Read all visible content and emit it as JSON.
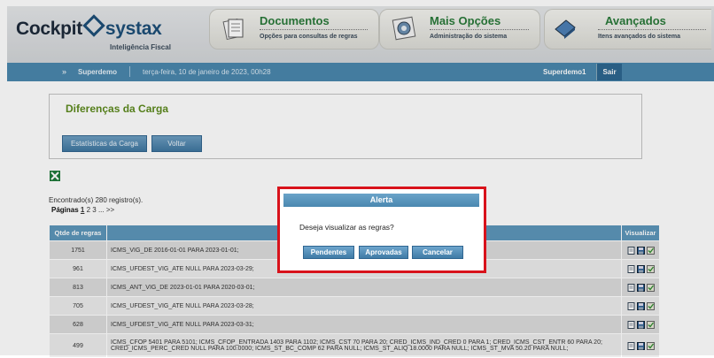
{
  "header": {
    "logo_left": "Cockpit",
    "logo_right": "systax",
    "logo_subtitle": "Inteligência Fiscal",
    "tabs": [
      {
        "title": "Documentos",
        "subtitle": "Opções para consultas de regras",
        "icon": "documents-icon"
      },
      {
        "title": "Mais Opções",
        "subtitle": "Administração do sistema",
        "icon": "gear-icon"
      },
      {
        "title": "Avançados",
        "subtitle": "Itens avançados do sistema",
        "icon": "pen-icon"
      }
    ]
  },
  "topbar": {
    "arrow": "»",
    "user": "Superdemo",
    "date": "terça-feira, 10 de janeiro de 2023, 00h28",
    "user_right": "Superdemo1",
    "logout": "Sair"
  },
  "panel": {
    "title": "Diferenças da Carga",
    "btn_stats": "Estatísticas da Carga",
    "btn_back": "Voltar"
  },
  "results": {
    "found": "Encontrado(s) 280 registro(s).",
    "pages_label": "Páginas",
    "pages_current": "1",
    "pages_rest": "2 3 ... >>"
  },
  "table": {
    "headers": [
      "Qtde de regras",
      "",
      "Visualizar"
    ],
    "rows": [
      {
        "qty": "1751",
        "rule": "ICMS_VIG_DE 2016-01-01 PARA 2023-01-01;"
      },
      {
        "qty": "961",
        "rule": "ICMS_UFDEST_VIG_ATE NULL PARA 2023-03-29;"
      },
      {
        "qty": "813",
        "rule": "ICMS_ANT_VIG_DE 2023-01-01 PARA 2020-03-01;"
      },
      {
        "qty": "705",
        "rule": "ICMS_UFDEST_VIG_ATE NULL PARA 2023-03-28;"
      },
      {
        "qty": "628",
        "rule": "ICMS_UFDEST_VIG_ATE NULL PARA 2023-03-31;"
      },
      {
        "qty": "499",
        "rule": "ICMS_CFOP 5401 PARA 5101; ICMS_CFOP_ENTRADA 1403 PARA 1102; ICMS_CST 70 PARA 20; CRED_ICMS_IND_CRED 0 PARA 1; CRED_ICMS_CST_ENTR 60 PARA 20; CRED_ICMS_PERC_CRED NULL PARA 100.0000; ICMS_ST_BC_COMP 62 PARA NULL; ICMS_ST_ALIQ 18.0000 PARA NULL; ICMS_ST_MVA 50.20 PARA NULL;"
      }
    ]
  },
  "modal": {
    "title": "Alerta",
    "message": "Deseja visualizar as regras?",
    "btn_pending": "Pendentes",
    "btn_approved": "Aprovadas",
    "btn_cancel": "Cancelar"
  },
  "colors": {
    "brand_blue": "#4a87ad",
    "title_green": "#5d8a1e",
    "alert_border": "#d8121b"
  }
}
